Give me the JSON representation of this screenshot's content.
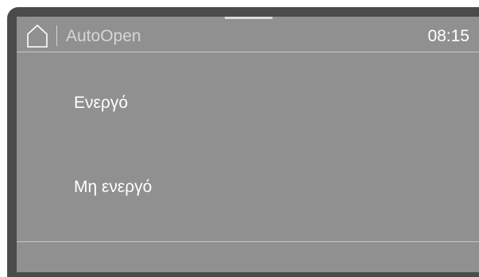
{
  "header": {
    "home_icon": "home-icon",
    "title": "AutoOpen",
    "time": "08:15"
  },
  "options": [
    {
      "label": "Ενεργό"
    },
    {
      "label": "Μη ενεργό"
    }
  ],
  "colors": {
    "bezel": "#4b4b4b",
    "screen": "#909090",
    "text": "#ffffff",
    "title_text": "#d6d6d6",
    "divider": "#c8c8c8"
  }
}
